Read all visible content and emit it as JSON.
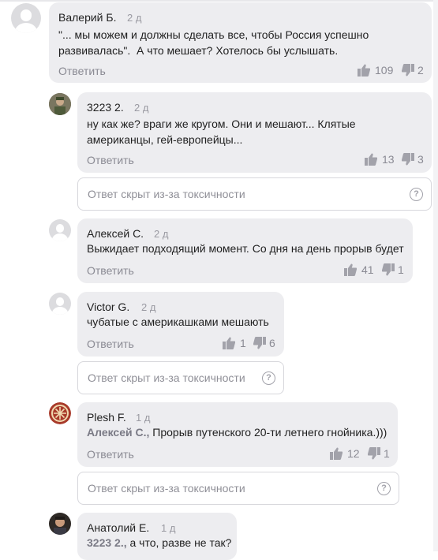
{
  "comments": [
    {
      "author": "Валерий Б.",
      "time": "2 д",
      "lines": [
        "\"... мы можем и должны сделать все, чтобы Россия успешно",
        "развивалась\".  А что мешает? Хотелось бы услышать."
      ],
      "reply": "Ответить",
      "likes": "109",
      "dislikes": "2"
    },
    {
      "author": "3223 2.",
      "time": "2 д",
      "lines": [
        "ну как же? враги же кругом. Они и мешают... Клятые",
        "американцы, гей-европейцы..."
      ],
      "reply": "Ответить",
      "likes": "13",
      "dislikes": "3",
      "hidden": "Ответ скрыт из-за токсичности"
    },
    {
      "author": "Алексей С.",
      "time": "2 д",
      "lines": [
        "Выжидает подходящий момент. Со дня на день прорыв будет"
      ],
      "reply": "Ответить",
      "likes": "41",
      "dislikes": "1"
    },
    {
      "author": "Victor G.",
      "time": "2 д",
      "lines": [
        "чубатые с америкашками мешають"
      ],
      "reply": "Ответить",
      "likes": "1",
      "dislikes": "6",
      "hidden": "Ответ скрыт из-за токсичности"
    },
    {
      "author": "Plesh F.",
      "time": "1 д",
      "mention": "Алексей С.,",
      "lines": [
        " Прорыв путенского 20-ти летнего гнойника.)))"
      ],
      "reply": "Ответить",
      "likes": "12",
      "dislikes": "1",
      "hidden": "Ответ скрыт из-за токсичности"
    },
    {
      "author": "Анатолий Е.",
      "time": "1 д",
      "mention": "3223 2.,",
      "lines": [
        " а что, разве не так?"
      ]
    }
  ],
  "colors": {
    "bubble": "#ededf0",
    "muted": "#8a8a93"
  },
  "icons": {
    "like": "thumb-up-icon",
    "dislike": "thumb-down-icon",
    "help": "question-icon"
  }
}
